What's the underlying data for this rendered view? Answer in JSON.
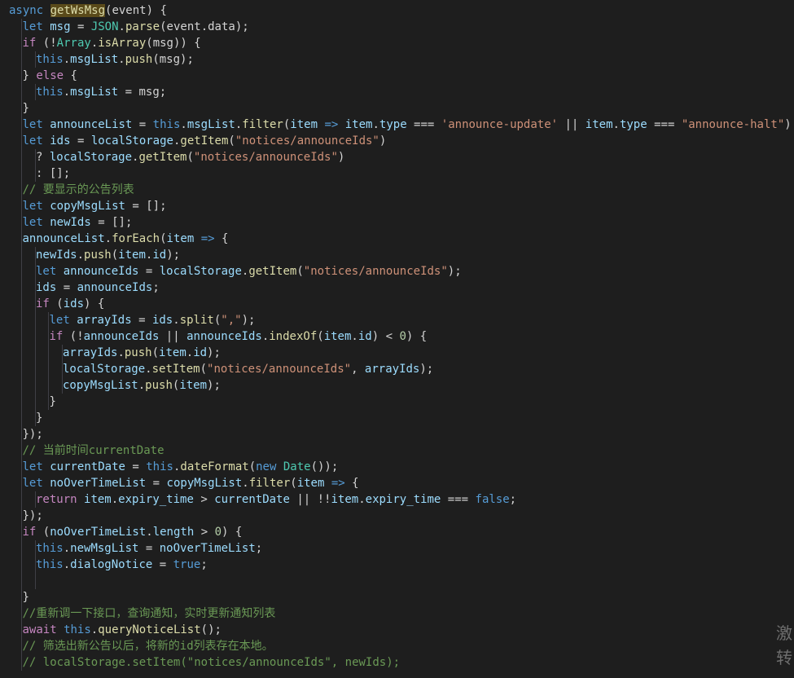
{
  "editor": {
    "theme_colors": {
      "background": "#1e1e1e",
      "keyword": "#569cd6",
      "control": "#c586c0",
      "variable": "#9cdcfe",
      "function": "#dcdcaa",
      "string": "#ce9178",
      "number": "#b5cea8",
      "comment": "#6a9955",
      "class": "#4ec9b0"
    },
    "lines": [
      {
        "indent": 0,
        "tokens": [
          [
            "kw",
            "async "
          ],
          [
            "fn hl",
            "getWsMsg"
          ],
          [
            "pun",
            "(event) {"
          ]
        ]
      },
      {
        "indent": 1,
        "tokens": [
          [
            "kw",
            "let "
          ],
          [
            "var",
            "msg"
          ],
          [
            "pun",
            " = "
          ],
          [
            "cls",
            "JSON"
          ],
          [
            "pun",
            "."
          ],
          [
            "fn",
            "parse"
          ],
          [
            "pun",
            "(event.data);"
          ]
        ]
      },
      {
        "indent": 1,
        "tokens": [
          [
            "ctl",
            "if "
          ],
          [
            "pun",
            "(!"
          ],
          [
            "cls",
            "Array"
          ],
          [
            "pun",
            "."
          ],
          [
            "fn",
            "isArray"
          ],
          [
            "pun",
            "(msg)) {"
          ]
        ]
      },
      {
        "indent": 2,
        "tokens": [
          [
            "kw",
            "this"
          ],
          [
            "pun",
            "."
          ],
          [
            "var",
            "msgList"
          ],
          [
            "pun",
            "."
          ],
          [
            "fn",
            "push"
          ],
          [
            "pun",
            "(msg);"
          ]
        ]
      },
      {
        "indent": 1,
        "tokens": [
          [
            "pun",
            "} "
          ],
          [
            "ctl",
            "else "
          ],
          [
            "pun",
            "{"
          ]
        ]
      },
      {
        "indent": 2,
        "tokens": [
          [
            "kw",
            "this"
          ],
          [
            "pun",
            "."
          ],
          [
            "var",
            "msgList"
          ],
          [
            "pun",
            " = msg;"
          ]
        ]
      },
      {
        "indent": 1,
        "tokens": [
          [
            "pun",
            "}"
          ]
        ]
      },
      {
        "indent": 1,
        "tokens": [
          [
            "kw",
            "let "
          ],
          [
            "var",
            "announceList"
          ],
          [
            "pun",
            " = "
          ],
          [
            "kw",
            "this"
          ],
          [
            "pun",
            "."
          ],
          [
            "var",
            "msgList"
          ],
          [
            "pun",
            "."
          ],
          [
            "fn",
            "filter"
          ],
          [
            "pun",
            "("
          ],
          [
            "var",
            "item"
          ],
          [
            "pun",
            " "
          ],
          [
            "kw",
            "=>"
          ],
          [
            "pun",
            " "
          ],
          [
            "var",
            "item"
          ],
          [
            "pun",
            "."
          ],
          [
            "var",
            "type"
          ],
          [
            "pun",
            " === "
          ],
          [
            "str",
            "'announce-update'"
          ],
          [
            "pun",
            " || "
          ],
          [
            "var",
            "item"
          ],
          [
            "pun",
            "."
          ],
          [
            "var",
            "type"
          ],
          [
            "pun",
            " === "
          ],
          [
            "str",
            "\"announce-halt\""
          ],
          [
            "pun",
            ")"
          ]
        ]
      },
      {
        "indent": 1,
        "tokens": [
          [
            "kw",
            "let "
          ],
          [
            "var",
            "ids"
          ],
          [
            "pun",
            " = "
          ],
          [
            "var",
            "localStorage"
          ],
          [
            "pun",
            "."
          ],
          [
            "fn",
            "getItem"
          ],
          [
            "pun",
            "("
          ],
          [
            "str",
            "\"notices/announceIds\""
          ],
          [
            "pun",
            ")"
          ]
        ]
      },
      {
        "indent": 2,
        "tokens": [
          [
            "pun",
            "? "
          ],
          [
            "var",
            "localStorage"
          ],
          [
            "pun",
            "."
          ],
          [
            "fn",
            "getItem"
          ],
          [
            "pun",
            "("
          ],
          [
            "str",
            "\"notices/announceIds\""
          ],
          [
            "pun",
            ")"
          ]
        ]
      },
      {
        "indent": 2,
        "tokens": [
          [
            "pun",
            ": [];"
          ]
        ]
      },
      {
        "indent": 1,
        "tokens": [
          [
            "cmt",
            "// 要显示的公告列表"
          ]
        ]
      },
      {
        "indent": 1,
        "tokens": [
          [
            "kw",
            "let "
          ],
          [
            "var",
            "copyMsgList"
          ],
          [
            "pun",
            " = [];"
          ]
        ]
      },
      {
        "indent": 1,
        "tokens": [
          [
            "kw",
            "let "
          ],
          [
            "var",
            "newIds"
          ],
          [
            "pun",
            " = [];"
          ]
        ]
      },
      {
        "indent": 1,
        "tokens": [
          [
            "var",
            "announceList"
          ],
          [
            "pun",
            "."
          ],
          [
            "fn",
            "forEach"
          ],
          [
            "pun",
            "("
          ],
          [
            "var",
            "item"
          ],
          [
            "pun",
            " "
          ],
          [
            "kw",
            "=>"
          ],
          [
            "pun",
            " {"
          ]
        ]
      },
      {
        "indent": 2,
        "tokens": [
          [
            "var",
            "newIds"
          ],
          [
            "pun",
            "."
          ],
          [
            "fn",
            "push"
          ],
          [
            "pun",
            "("
          ],
          [
            "var",
            "item"
          ],
          [
            "pun",
            "."
          ],
          [
            "var",
            "id"
          ],
          [
            "pun",
            ");"
          ]
        ]
      },
      {
        "indent": 2,
        "tokens": [
          [
            "kw",
            "let "
          ],
          [
            "var",
            "announceIds"
          ],
          [
            "pun",
            " = "
          ],
          [
            "var",
            "localStorage"
          ],
          [
            "pun",
            "."
          ],
          [
            "fn",
            "getItem"
          ],
          [
            "pun",
            "("
          ],
          [
            "str",
            "\"notices/announceIds\""
          ],
          [
            "pun",
            ");"
          ]
        ]
      },
      {
        "indent": 2,
        "tokens": [
          [
            "var",
            "ids"
          ],
          [
            "pun",
            " = "
          ],
          [
            "var",
            "announceIds"
          ],
          [
            "pun",
            ";"
          ]
        ]
      },
      {
        "indent": 2,
        "tokens": [
          [
            "ctl",
            "if "
          ],
          [
            "pun",
            "("
          ],
          [
            "var",
            "ids"
          ],
          [
            "pun",
            ") {"
          ]
        ]
      },
      {
        "indent": 3,
        "tokens": [
          [
            "kw",
            "let "
          ],
          [
            "var",
            "arrayIds"
          ],
          [
            "pun",
            " = "
          ],
          [
            "var",
            "ids"
          ],
          [
            "pun",
            "."
          ],
          [
            "fn",
            "split"
          ],
          [
            "pun",
            "("
          ],
          [
            "str",
            "\",\""
          ],
          [
            "pun",
            ");"
          ]
        ]
      },
      {
        "indent": 3,
        "tokens": [
          [
            "ctl",
            "if "
          ],
          [
            "pun",
            "(!"
          ],
          [
            "var",
            "announceIds"
          ],
          [
            "pun",
            " || "
          ],
          [
            "var",
            "announceIds"
          ],
          [
            "pun",
            "."
          ],
          [
            "fn",
            "indexOf"
          ],
          [
            "pun",
            "("
          ],
          [
            "var",
            "item"
          ],
          [
            "pun",
            "."
          ],
          [
            "var",
            "id"
          ],
          [
            "pun",
            ") < "
          ],
          [
            "num",
            "0"
          ],
          [
            "pun",
            ") {"
          ]
        ]
      },
      {
        "indent": 4,
        "tokens": [
          [
            "var",
            "arrayIds"
          ],
          [
            "pun",
            "."
          ],
          [
            "fn",
            "push"
          ],
          [
            "pun",
            "("
          ],
          [
            "var",
            "item"
          ],
          [
            "pun",
            "."
          ],
          [
            "var",
            "id"
          ],
          [
            "pun",
            ");"
          ]
        ]
      },
      {
        "indent": 4,
        "tokens": [
          [
            "var",
            "localStorage"
          ],
          [
            "pun",
            "."
          ],
          [
            "fn",
            "setItem"
          ],
          [
            "pun",
            "("
          ],
          [
            "str",
            "\"notices/announceIds\""
          ],
          [
            "pun",
            ", "
          ],
          [
            "var",
            "arrayIds"
          ],
          [
            "pun",
            ");"
          ]
        ]
      },
      {
        "indent": 4,
        "tokens": [
          [
            "var",
            "copyMsgList"
          ],
          [
            "pun",
            "."
          ],
          [
            "fn",
            "push"
          ],
          [
            "pun",
            "("
          ],
          [
            "var",
            "item"
          ],
          [
            "pun",
            ");"
          ]
        ]
      },
      {
        "indent": 3,
        "tokens": [
          [
            "pun",
            "}"
          ]
        ]
      },
      {
        "indent": 2,
        "tokens": [
          [
            "pun",
            "}"
          ]
        ]
      },
      {
        "indent": 1,
        "tokens": [
          [
            "pun",
            "});"
          ]
        ]
      },
      {
        "indent": 1,
        "tokens": [
          [
            "cmt",
            "// 当前时间currentDate"
          ]
        ]
      },
      {
        "indent": 1,
        "tokens": [
          [
            "kw",
            "let "
          ],
          [
            "var",
            "currentDate"
          ],
          [
            "pun",
            " = "
          ],
          [
            "kw",
            "this"
          ],
          [
            "pun",
            "."
          ],
          [
            "fn",
            "dateFormat"
          ],
          [
            "pun",
            "("
          ],
          [
            "kw",
            "new "
          ],
          [
            "cls",
            "Date"
          ],
          [
            "pun",
            "());"
          ]
        ]
      },
      {
        "indent": 1,
        "tokens": [
          [
            "kw",
            "let "
          ],
          [
            "var",
            "noOverTimeList"
          ],
          [
            "pun",
            " = "
          ],
          [
            "var",
            "copyMsgList"
          ],
          [
            "pun",
            "."
          ],
          [
            "fn",
            "filter"
          ],
          [
            "pun",
            "("
          ],
          [
            "var",
            "item"
          ],
          [
            "pun",
            " "
          ],
          [
            "kw",
            "=>"
          ],
          [
            "pun",
            " {"
          ]
        ]
      },
      {
        "indent": 2,
        "tokens": [
          [
            "ctl",
            "return "
          ],
          [
            "var",
            "item"
          ],
          [
            "pun",
            "."
          ],
          [
            "var",
            "expiry_time"
          ],
          [
            "pun",
            " > "
          ],
          [
            "var",
            "currentDate"
          ],
          [
            "pun",
            " || !!"
          ],
          [
            "var",
            "item"
          ],
          [
            "pun",
            "."
          ],
          [
            "var",
            "expiry_time"
          ],
          [
            "pun",
            " === "
          ],
          [
            "kw",
            "false"
          ],
          [
            "pun",
            ";"
          ]
        ]
      },
      {
        "indent": 1,
        "tokens": [
          [
            "pun",
            "});"
          ]
        ]
      },
      {
        "indent": 1,
        "tokens": [
          [
            "ctl",
            "if "
          ],
          [
            "pun",
            "("
          ],
          [
            "var",
            "noOverTimeList"
          ],
          [
            "pun",
            "."
          ],
          [
            "var",
            "length"
          ],
          [
            "pun",
            " > "
          ],
          [
            "num",
            "0"
          ],
          [
            "pun",
            ") {"
          ]
        ]
      },
      {
        "indent": 2,
        "tokens": [
          [
            "kw",
            "this"
          ],
          [
            "pun",
            "."
          ],
          [
            "var",
            "newMsgList"
          ],
          [
            "pun",
            " = "
          ],
          [
            "var",
            "noOverTimeList"
          ],
          [
            "pun",
            ";"
          ]
        ]
      },
      {
        "indent": 2,
        "tokens": [
          [
            "kw",
            "this"
          ],
          [
            "pun",
            "."
          ],
          [
            "var",
            "dialogNotice"
          ],
          [
            "pun",
            " = "
          ],
          [
            "kw",
            "true"
          ],
          [
            "pun",
            ";"
          ]
        ]
      },
      {
        "indent": 2,
        "tokens": []
      },
      {
        "indent": 1,
        "tokens": [
          [
            "pun",
            "}"
          ]
        ]
      },
      {
        "indent": 1,
        "tokens": [
          [
            "cmt",
            "//重新调一下接口，查询通知，实时更新通知列表"
          ]
        ]
      },
      {
        "indent": 1,
        "tokens": [
          [
            "ctl",
            "await "
          ],
          [
            "kw",
            "this"
          ],
          [
            "pun",
            "."
          ],
          [
            "fn",
            "queryNoticeList"
          ],
          [
            "pun",
            "();"
          ]
        ]
      },
      {
        "indent": 1,
        "tokens": [
          [
            "cmt",
            "// 筛选出新公告以后，将新的id列表存在本地。"
          ]
        ]
      },
      {
        "indent": 1,
        "tokens": [
          [
            "cmt",
            "// localStorage.setItem(\"notices/announceIds\", newIds);"
          ]
        ]
      }
    ]
  },
  "watermark": {
    "text": "激转"
  }
}
